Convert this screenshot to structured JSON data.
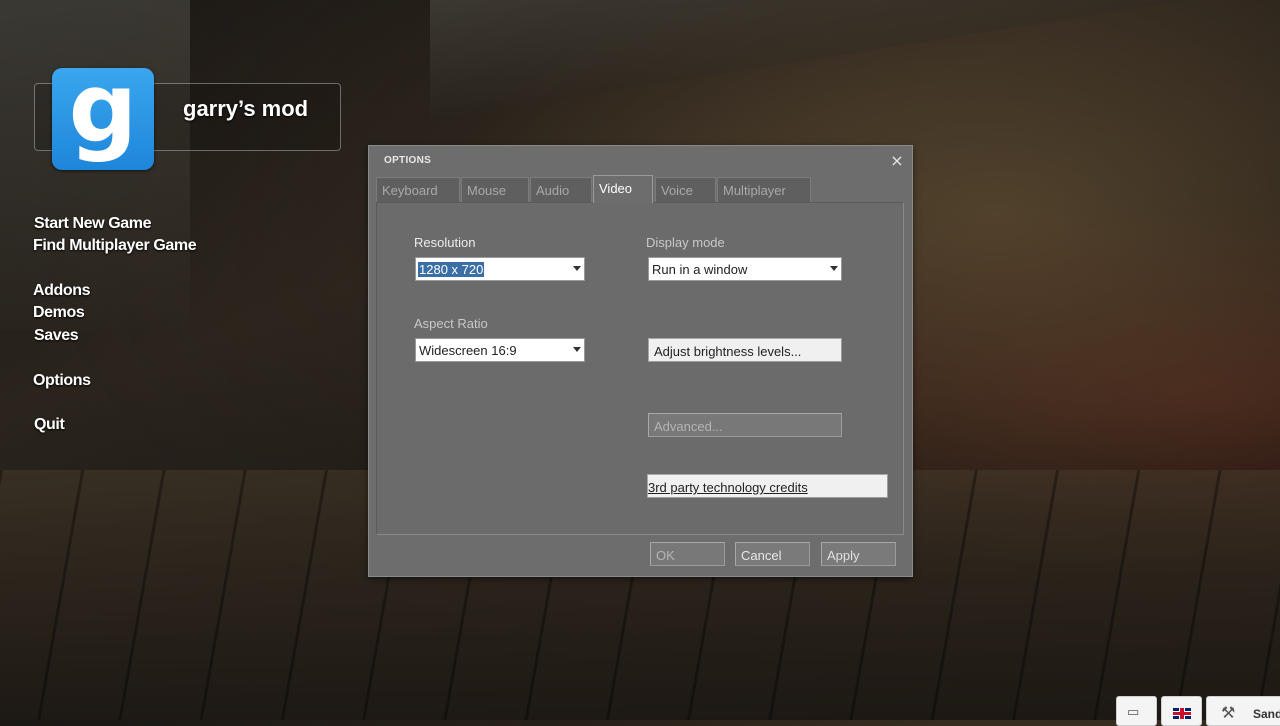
{
  "logo": {
    "letter": "g",
    "title": "garry’s mod"
  },
  "menu": {
    "start_new_game": "Start New Game",
    "find_multiplayer": "Find Multiplayer Game",
    "addons": "Addons",
    "demos": "Demos",
    "saves": "Saves",
    "options": "Options",
    "quit": "Quit"
  },
  "dialog": {
    "title": "OPTIONS",
    "close": "×",
    "tabs": [
      {
        "label": "Keyboard",
        "active": false
      },
      {
        "label": "Mouse",
        "active": false
      },
      {
        "label": "Audio",
        "active": false
      },
      {
        "label": "Video",
        "active": true
      },
      {
        "label": "Voice",
        "active": false
      },
      {
        "label": "Multiplayer",
        "active": false
      }
    ],
    "video": {
      "resolution_label": "Resolution",
      "resolution_value": "1280 x 720",
      "display_mode_label": "Display mode",
      "display_mode_value": "Run in a window",
      "aspect_ratio_label": "Aspect Ratio",
      "aspect_ratio_value": "Widescreen 16:9",
      "brightness_button": "Adjust brightness levels...",
      "advanced_button": "Advanced...",
      "credits_button": "3rd party technology credits"
    },
    "footer": {
      "ok": "OK",
      "cancel": "Cancel",
      "apply": "Apply"
    }
  },
  "corner": {
    "gamemode_label": "Sand"
  }
}
